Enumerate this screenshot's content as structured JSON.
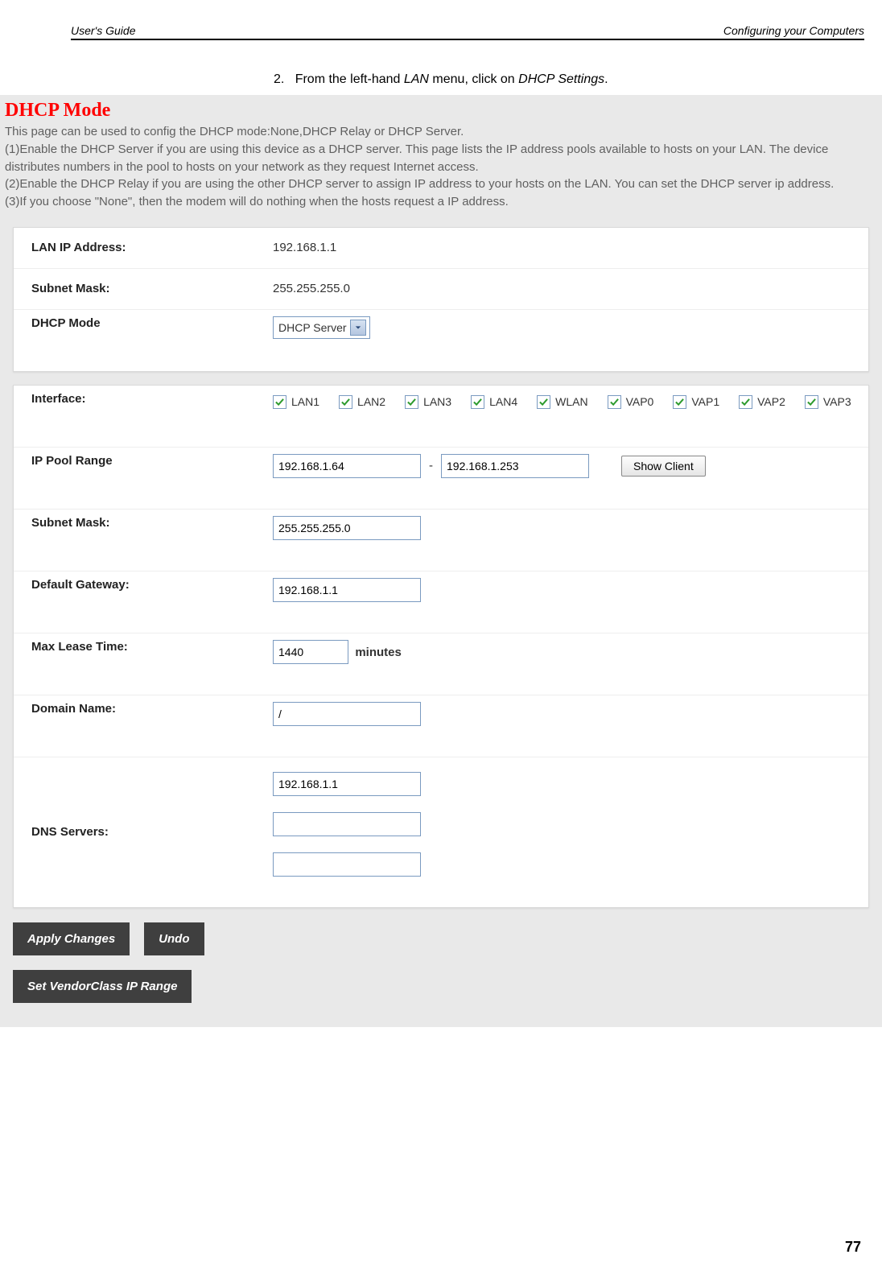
{
  "header": {
    "left": "User's Guide",
    "right": "Configuring your Computers"
  },
  "step": {
    "num": "2.",
    "pre": "From the left-hand ",
    "em1": "LAN",
    "mid": " menu, click on ",
    "em2": "DHCP Settings",
    "post": "."
  },
  "section_title": "DHCP Mode",
  "intro": {
    "l1": "This page can be used to config the DHCP mode:None,DHCP Relay or DHCP Server.",
    "l2": "(1)Enable the DHCP Server if you are using this device as a DHCP server. This page lists the IP address pools available to hosts on your LAN. The device distributes numbers in the pool to hosts on your network as they request Internet access.",
    "l3": "(2)Enable the DHCP Relay if you are using the other DHCP server to assign IP address to your hosts on the LAN. You can set the DHCP server ip address.",
    "l4": "(3)If you choose \"None\", then the modem will do nothing when the hosts request a IP address."
  },
  "panel1": {
    "lan_ip_label": "LAN IP Address:",
    "lan_ip_value": "192.168.1.1",
    "subnet_label": "Subnet Mask:",
    "subnet_value": "255.255.255.0",
    "dhcp_mode_label": "DHCP Mode",
    "dhcp_mode_value": "DHCP Server"
  },
  "panel2": {
    "interface_label": "Interface:",
    "interfaces": [
      "LAN1",
      "LAN2",
      "LAN3",
      "LAN4",
      "WLAN",
      "VAP0",
      "VAP1",
      "VAP2",
      "VAP3"
    ],
    "pool_label": "IP Pool Range",
    "pool_start": "192.168.1.64",
    "pool_end": "192.168.1.253",
    "show_client": "Show Client",
    "subnet_label": "Subnet Mask:",
    "subnet_value": "255.255.255.0",
    "gateway_label": "Default Gateway:",
    "gateway_value": "192.168.1.1",
    "lease_label": "Max Lease Time:",
    "lease_value": "1440",
    "lease_unit": "minutes",
    "domain_label": "Domain Name:",
    "domain_value": "/",
    "dns_label": "DNS Servers:",
    "dns1": "192.168.1.1",
    "dns2": "",
    "dns3": ""
  },
  "buttons": {
    "apply": "Apply Changes",
    "undo": "Undo",
    "vendor": "Set VendorClass IP Range"
  },
  "page_number": "77"
}
